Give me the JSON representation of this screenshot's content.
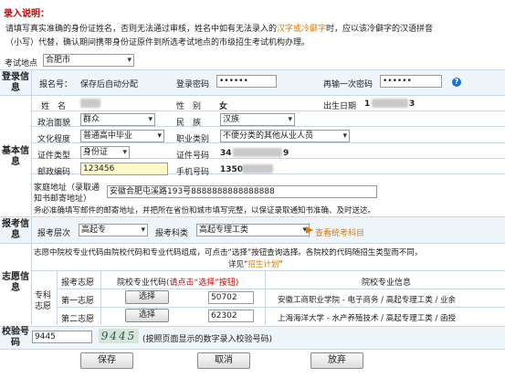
{
  "notice": {
    "title": "录入说明：",
    "line1_a": "请填写真实准确的身份证姓名，否则无法通过审核，姓名中如有无法录入的",
    "line1_b": "汉字或冷僻字",
    "line1_c": "时，应以该冷僻字的汉语拼音",
    "line2": "（小写）代替，确认期间携带身份证原件到所选考试地点的市级招生考试机构办理。"
  },
  "exam_place": {
    "label": "考试地点",
    "value": "合肥市"
  },
  "login": {
    "section": "登录信息",
    "regno_label": "报名号：",
    "regno_value": "保存后自动分配",
    "pwd_label": "登录密码",
    "pwd_value": "••••••",
    "pwd2_label": "再输一次密码",
    "pwd2_value": "••••••",
    "help": "?"
  },
  "basic": {
    "section": "基本信息",
    "name_label": "姓　名",
    "gender_label": "性　别",
    "gender_value": "女",
    "birth_label": "出生日期",
    "birth_value": "1",
    "birth_tail": "3",
    "political_label": "政治面貌",
    "political_value": "群众",
    "ethnic_label": "民　族",
    "ethnic_value": "汉族",
    "edu_label": "文化程度",
    "edu_value": "普通高中毕业",
    "job_label": "职业类别",
    "job_value": "不便分类的其他从业人员",
    "idtype_label": "证件类型",
    "idtype_value": "身份证",
    "idno_label": "证件号码",
    "idno_value": "34",
    "idno_tail": "9",
    "zip_label": "邮政编码",
    "zip_value": "123456",
    "phone_label": "手机号码",
    "phone_value": "1350",
    "addr_label1": "家庭地址（录取通",
    "addr_label2": "知书邮寄地址）",
    "addr_value": "安徽合肥屯溪路193号8888888888888888",
    "addr_note": "务必准确填写邮件的邮寄地址，并把所在省份和城市填写完整，以保证录取通知书准确、及时送达。"
  },
  "apply": {
    "section": "报考信息",
    "level_label": "报考层次",
    "level_value": "高起专",
    "subject_label": "报考科类",
    "subject_value": "高起专理工类",
    "view_link": "查看统考科目"
  },
  "wish": {
    "section": "志愿信息",
    "note_a": "志愿中院校专业代码由院校代码和专业代码组成，可点击“选择”按钮查询选择。各院校的代码随招生类型而不同，",
    "note_b_a": "详见“",
    "note_b_link": "招生计划",
    "note_b_c": "”",
    "col_wish": "报考志愿",
    "col_code": "院校专业代码",
    "col_code_hint": "(请点击“选择”按钮)",
    "col_info": "院校专业信息",
    "group_label": "专科志愿",
    "rows": [
      {
        "label": "第一志愿",
        "btn": "选择",
        "code": "50702",
        "info": "安徽工商职业学院 - 电子商务 / 高起专理工类 / 业余"
      },
      {
        "label": "第二志愿",
        "btn": "选择",
        "code": "62302",
        "info": "上海海洋大学 - 水产养殖技术 / 高起专理工类 / 函授"
      }
    ]
  },
  "verify": {
    "section": "校验号码",
    "value": "9445",
    "captcha": "9445",
    "hint": "(按照页面显示的数字录入校验号码)"
  },
  "buttons": {
    "save": "保存",
    "cancel": "取消",
    "discard": "放弃"
  }
}
